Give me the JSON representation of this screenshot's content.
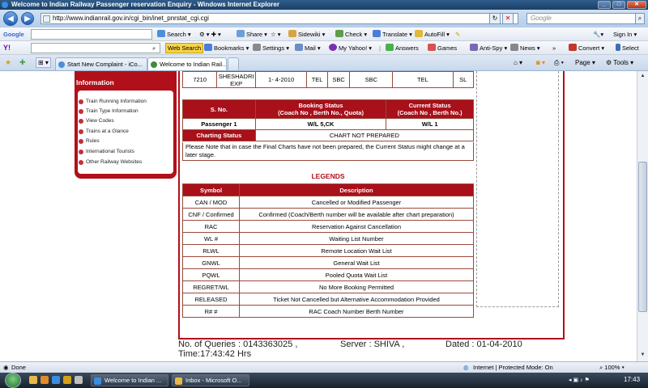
{
  "window": {
    "title": "Welcome to Indian Railway Passenger reservation Enquiry - Windows Internet Explorer"
  },
  "address": {
    "url": "http://www.indianrail.gov.in/cgi_bin/inet_pnrstat_cgi.cgi",
    "search_placeholder": "Google"
  },
  "google_toolbar": {
    "logo": "Google",
    "search": "Search",
    "share": "Share",
    "sidewiki": "Sidewiki",
    "check": "Check",
    "translate": "Translate",
    "autofill": "AutoFill",
    "signin": "Sign In"
  },
  "yahoo_toolbar": {
    "logo": "Y!",
    "web_search": "Web Search",
    "bookmarks": "Bookmarks",
    "settings": "Settings",
    "mail": "Mail",
    "my_yahoo": "My Yahoo!",
    "answers": "Answers",
    "games": "Games",
    "antispy": "Anti-Spy",
    "news": "News",
    "convert": "Convert",
    "select": "Select"
  },
  "tabs": [
    {
      "label": "Start New Complaint - iCo..."
    },
    {
      "label": "Welcome to Indian Rail..."
    }
  ],
  "tab_tools": {
    "page": "Page",
    "tools": "Tools"
  },
  "sidebar": {
    "title": "Information",
    "items": [
      "Train Running Information",
      "Train Type Information",
      "View Codes",
      "Trains at a Glance",
      "Rules",
      "International Tourists",
      "Other Railway Websites"
    ]
  },
  "train_row": {
    "number": "7210",
    "name": "SHESHADRI EXP",
    "date": "1- 4-2010",
    "from": "TEL",
    "to": "SBC",
    "upto": "SBC",
    "boarding": "TEL",
    "class": "SL"
  },
  "booking": {
    "headers": {
      "sno": "S. No.",
      "booking": "Booking Status",
      "booking_sub": "(Coach No , Berth No., Quota)",
      "current": "Current Status",
      "current_sub": "(Coach No , Berth No.)"
    },
    "passenger": "Passenger 1",
    "booking_status": "W/L 5,CK",
    "current_status": "W/L 1",
    "charting_label": "Charting Status",
    "charting_value": "CHART NOT PREPARED",
    "note": "Please Note that in case the Final Charts have not been prepared, the Current Status might change at a later stage."
  },
  "legends": {
    "title": "LEGENDS",
    "col_symbol": "Symbol",
    "col_desc": "Description",
    "rows": [
      {
        "sym": "CAN / MOD",
        "desc": "Cancelled or Modified Passenger"
      },
      {
        "sym": "CNF / Confirmed",
        "desc": "Confirmed (Coach/Berth number will be available after chart preparation)"
      },
      {
        "sym": "RAC",
        "desc": "Reservation Against Cancellation"
      },
      {
        "sym": "WL #",
        "desc": "Waiting List Number"
      },
      {
        "sym": "RLWL",
        "desc": "Remote Location Wait List"
      },
      {
        "sym": "GNWL",
        "desc": "General Wait List"
      },
      {
        "sym": "PQWL",
        "desc": "Pooled Quota Wait List"
      },
      {
        "sym": "REGRET/WL",
        "desc": "No More Booking Permitted"
      },
      {
        "sym": "RELEASED",
        "desc": "Ticket Not Cancelled but Alternative Accommodation Provided"
      },
      {
        "sym": "R# #",
        "desc": "RAC Coach Number Berth Number"
      }
    ]
  },
  "footer": {
    "queries": "No. of Queries : 0143363025 ,",
    "server": "Server : SHIVA ,",
    "dated": "Dated : 01-04-2010",
    "time": "Time:17:43:42 Hrs"
  },
  "status": {
    "left": "Done",
    "zone": "Internet | Protected Mode: On",
    "zoom": "100%"
  },
  "taskbar": {
    "tasks": [
      "Welcome to Indian ...",
      "Inbox - Microsoft O..."
    ],
    "clock": "17:43"
  }
}
